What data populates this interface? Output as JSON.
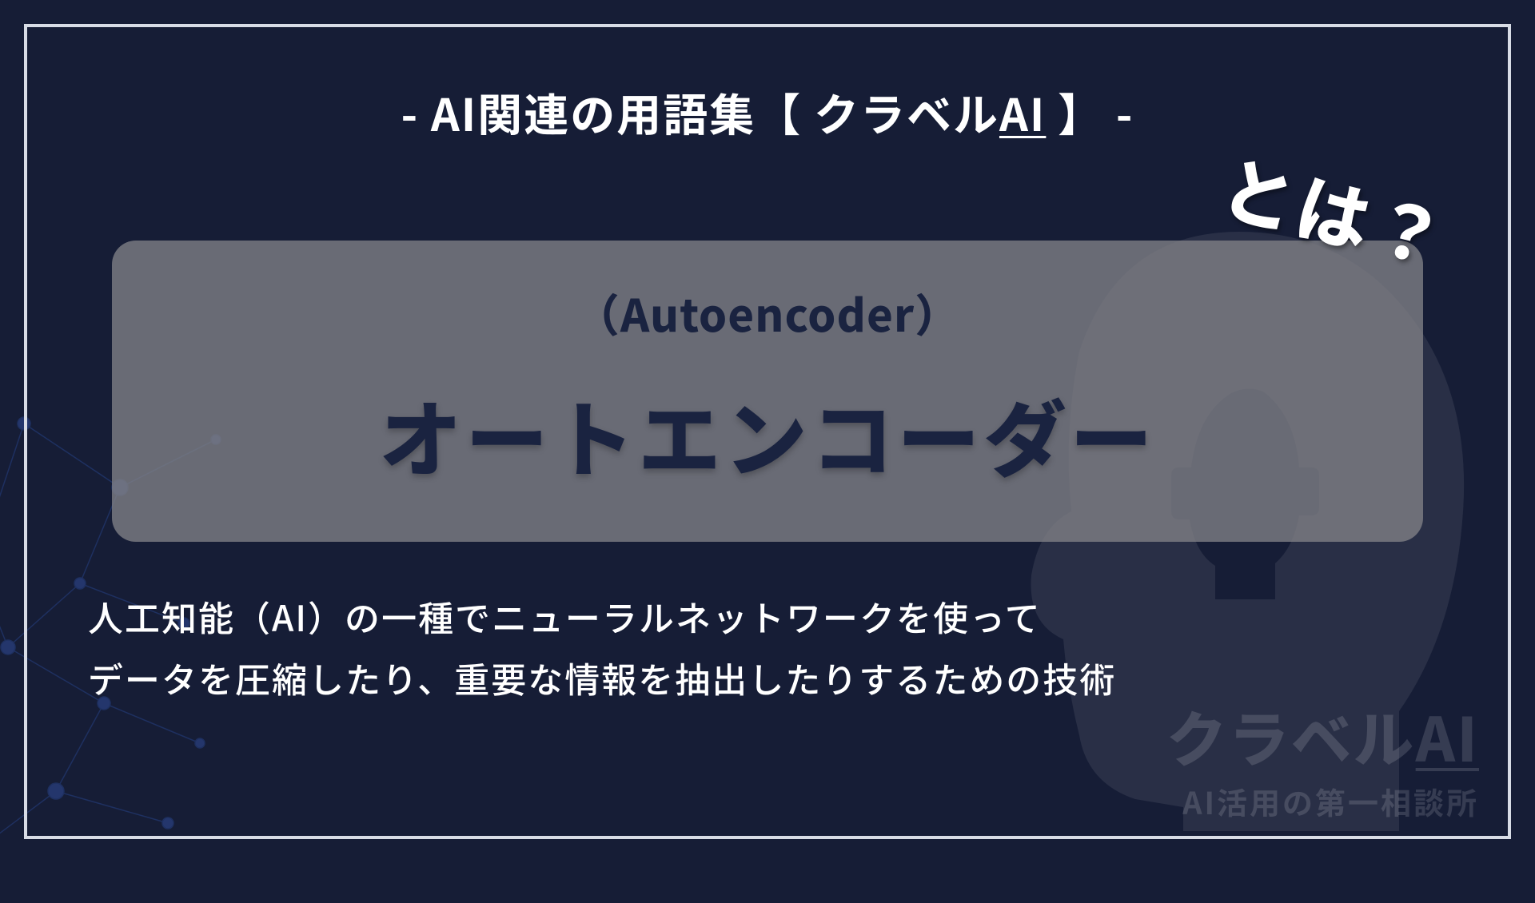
{
  "header": {
    "prefix": "- AI関連の用語集【 クラベル",
    "ai": "AI",
    "suffix": " 】 -"
  },
  "term": {
    "english": "（Autoencoder）",
    "japanese": "オートエンコーダー",
    "towha": "とは？"
  },
  "description": {
    "line1": "人工知能（AI）の一種でニューラルネットワークを使って",
    "line2": "データを圧縮したり、重要な情報を抽出したりするための技術"
  },
  "brand": {
    "name_prefix": "クラベル",
    "name_ai": "AI",
    "tagline": "AI活用の第一相談所"
  }
}
